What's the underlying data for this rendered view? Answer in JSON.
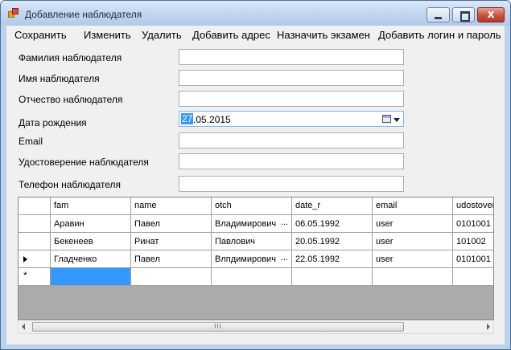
{
  "window": {
    "title": "Добавление наблюдателя",
    "app_icon": "app-icon",
    "controls": {
      "minimize": "minimize-icon",
      "maximize": "maximize-icon",
      "close": "close-icon",
      "close_glyph": "x"
    }
  },
  "menu": {
    "items": [
      "Сохранить",
      "Изменить",
      "Удалить",
      "Добавить адрес",
      "Назначить экзамен",
      "Добавить логин и пароль"
    ]
  },
  "form": {
    "last_name_label": "Фамилия наблюдателя",
    "last_name_value": "",
    "first_name_label": "Имя наблюдателя",
    "first_name_value": "",
    "middle_name_label": "Отчество наблюдателя",
    "middle_name_value": "",
    "birth_date_label": "Дата рождения",
    "birth_date_day": "27",
    "birth_date_rest": ".05.2015",
    "email_label": "Email",
    "email_value": "",
    "id_label": "Удостоверение наблюдателя",
    "id_value": "",
    "phone_label": "Телефон наблюдателя",
    "phone_value": ""
  },
  "grid": {
    "columns": [
      "fam",
      "name",
      "otch",
      "date_r",
      "email",
      "udostover"
    ],
    "rows": [
      {
        "fam": "Аравин",
        "name": "Павел",
        "otch": "Владимирович",
        "date_r": "06.05.1992",
        "email": "user",
        "udostover": "0101001"
      },
      {
        "fam": "Бекенеев",
        "name": "Ринат",
        "otch": "Павлович",
        "date_r": "20.05.1992",
        "email": "user",
        "udostover": "101002"
      },
      {
        "fam": "Гладченко",
        "name": "Павел",
        "otch": "Влпдимирович",
        "date_r": "22.05.1992",
        "email": "user",
        "udostover": "0101001"
      }
    ],
    "ellipsis": "...",
    "current_row_marker": "current-row-arrow-icon",
    "new_row_marker": "*"
  },
  "scrollbar": {
    "thumb_grip": "III"
  },
  "colors": {
    "selection": "#3399ff",
    "grid_background": "#ababab",
    "client_background": "#f0f0f0"
  }
}
